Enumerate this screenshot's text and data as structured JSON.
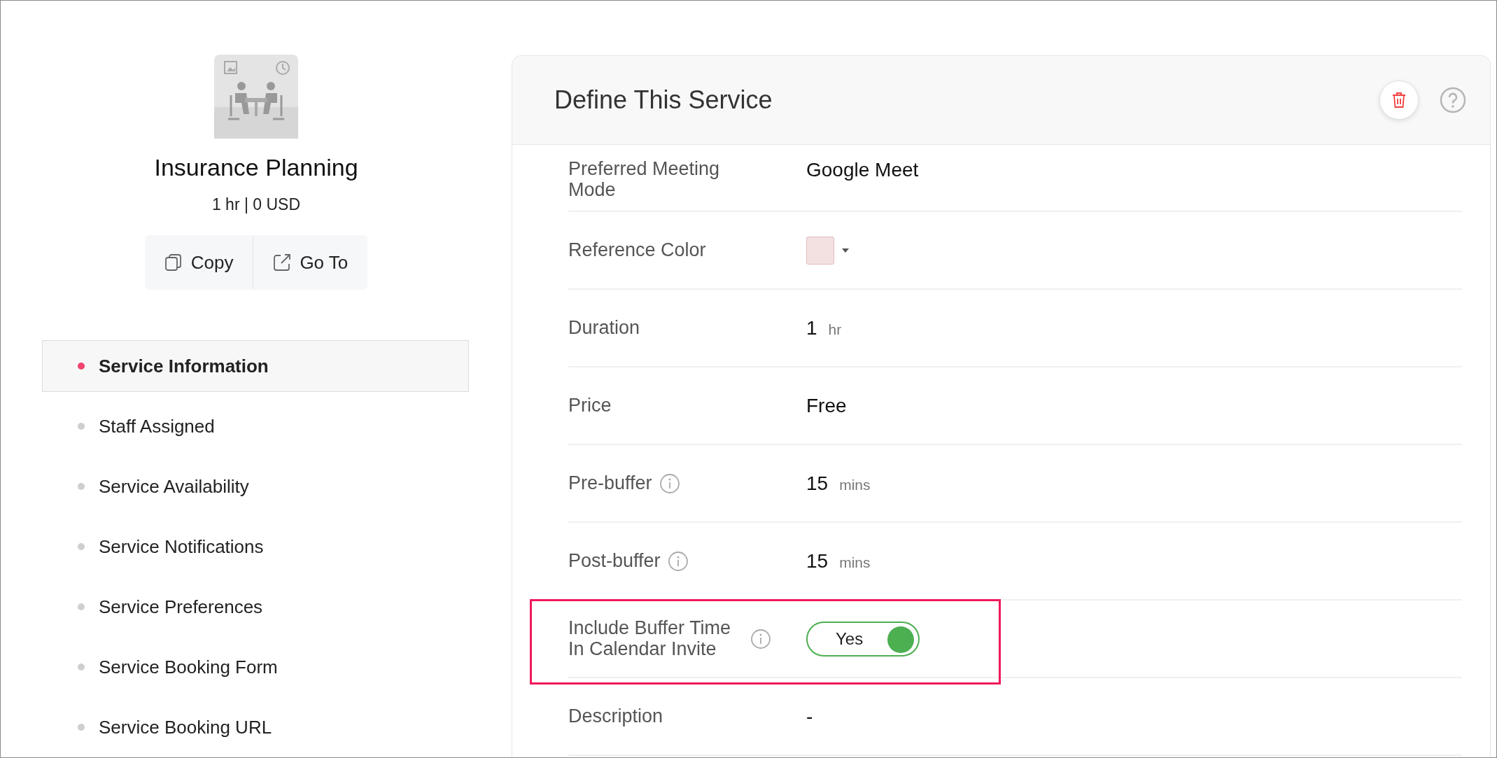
{
  "service": {
    "title": "Insurance Planning",
    "summary": "1 hr | 0 USD",
    "actions": [
      {
        "label": "Copy",
        "kind": "copy"
      },
      {
        "label": "Go To",
        "kind": "goto"
      }
    ]
  },
  "nav": [
    {
      "label": "Service Information",
      "selected": true
    },
    {
      "label": "Staff Assigned",
      "selected": false
    },
    {
      "label": "Service Availability",
      "selected": false
    },
    {
      "label": "Service Notifications",
      "selected": false
    },
    {
      "label": "Service Preferences",
      "selected": false
    },
    {
      "label": "Service Booking Form",
      "selected": false
    },
    {
      "label": "Service Booking URL",
      "selected": false
    }
  ],
  "panel": {
    "title": "Define This Service",
    "fields": [
      {
        "kind": "text",
        "label": "Preferred Meeting Mode",
        "value": "Google Meet"
      },
      {
        "kind": "color",
        "label": "Reference Color",
        "color": "#f3e1e1"
      },
      {
        "kind": "quantity",
        "label": "Duration",
        "value": "1",
        "unit": "hr"
      },
      {
        "kind": "text",
        "label": "Price",
        "value": "Free"
      },
      {
        "kind": "quantity",
        "label": "Pre-buffer",
        "info": true,
        "value": "15",
        "unit": "mins"
      },
      {
        "kind": "quantity",
        "label": "Post-buffer",
        "info": true,
        "value": "15",
        "unit": "mins"
      },
      {
        "kind": "toggle",
        "label": "Include Buffer Time In Calendar Invite",
        "info": true,
        "on": true,
        "value": "Yes",
        "highlighted": true
      },
      {
        "kind": "text",
        "label": "Description",
        "value": "-"
      }
    ]
  }
}
